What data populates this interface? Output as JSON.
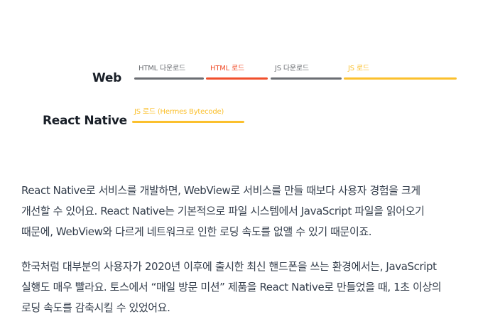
{
  "diagram": {
    "web_label": "Web",
    "react_native_label": "React Native",
    "web_segments": [
      {
        "label": "HTML 다운로드",
        "color": "#6b6e73"
      },
      {
        "label": "HTML 로드",
        "color": "#f04f2c"
      },
      {
        "label": "JS 다운로드",
        "color": "#6b6e73"
      },
      {
        "label": "JS 로드",
        "color": "#fbc02d"
      }
    ],
    "rn_segments": [
      {
        "label": "JS 로드 (Hermes Bytecode)",
        "color": "#fbc02d"
      }
    ]
  },
  "article": {
    "paragraph1": [
      "React Native로 서비스를 개발하면, WebView로 서비스를 만들 때보다 사용자 경험을 크게",
      "개선할 수 있어요. React Native는 기본적으로 파일 시스템에서 JavaScript 파일을 읽어오기",
      "때문에, WebView와 다르게 네트워크로 인한 로딩 속도를 없앨 수 있기 때문이죠."
    ],
    "paragraph2": [
      "한국처럼 대부분의 사용자가 2020년 이후에 출시한 최신 핸드폰을 쓰는 환경에서는, JavaScript",
      "실행도 매우 빨라요. 토스에서 “매일 방문 미션” 제품을 React Native로 만들었을 때, 1초 이상의",
      "로딩 속도를 감축시킬 수 있었어요."
    ]
  }
}
